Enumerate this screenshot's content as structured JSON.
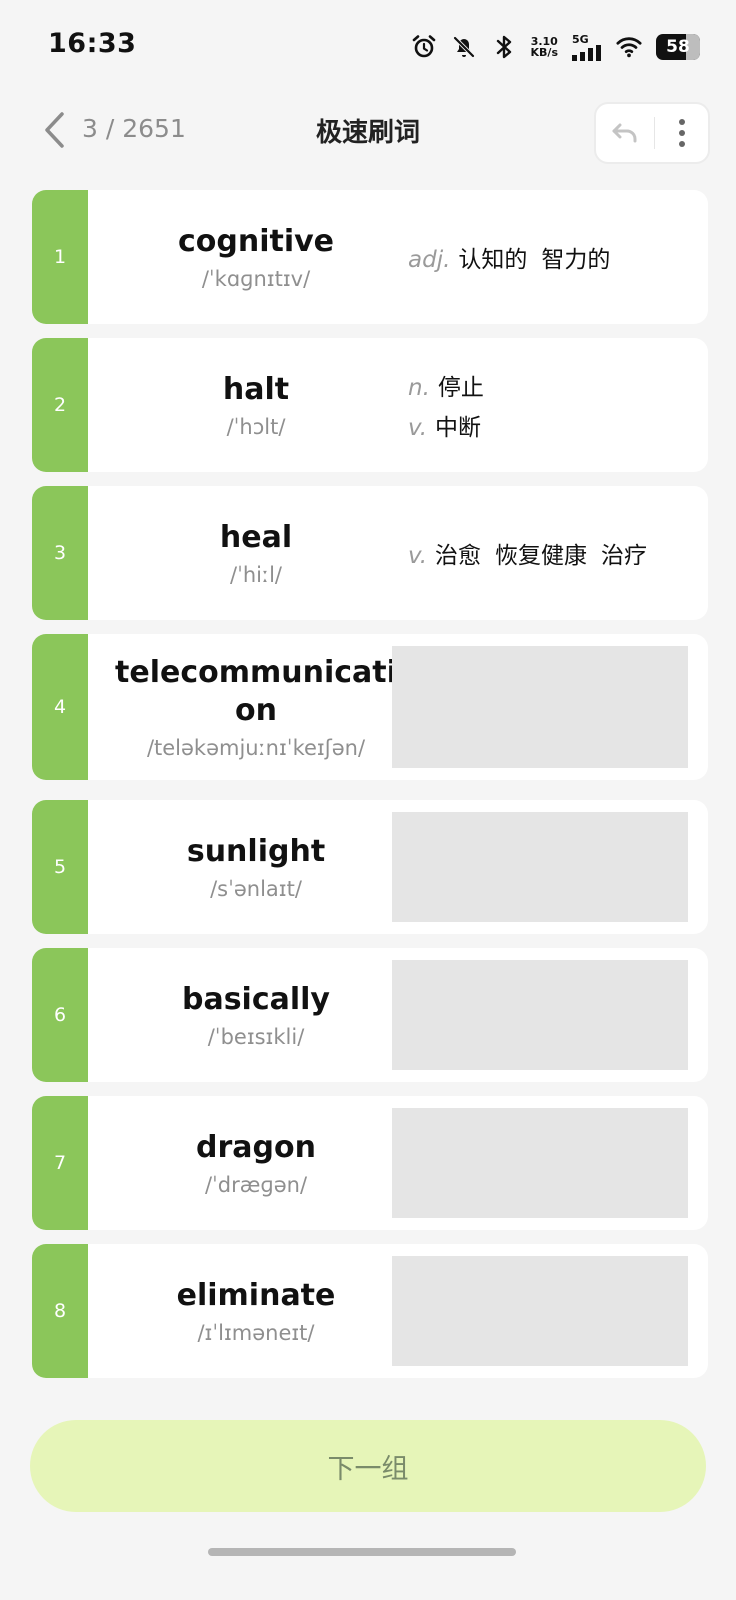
{
  "status_bar": {
    "time": "16:33",
    "net_speed_value": "3.10",
    "net_speed_unit": "KB/s",
    "network_type": "5G",
    "battery": "58",
    "icons": [
      "alarm-icon",
      "bell-off-icon",
      "bluetooth-icon",
      "signal-icon",
      "wifi-icon",
      "battery-icon"
    ]
  },
  "header": {
    "progress": "3 / 2651",
    "title": "极速刷词"
  },
  "words": [
    {
      "index": "1",
      "word": "cognitive",
      "phonetic": "/ˈkɑɡnɪtɪv/",
      "revealed": true,
      "definitions": [
        {
          "pos": "adj.",
          "meanings": [
            "认知的",
            "智力的"
          ]
        }
      ]
    },
    {
      "index": "2",
      "word": "halt",
      "phonetic": "/ˈhɔlt/",
      "revealed": true,
      "definitions": [
        {
          "pos": "n.",
          "meanings": [
            "停止"
          ]
        },
        {
          "pos": "v.",
          "meanings": [
            "中断"
          ]
        }
      ]
    },
    {
      "index": "3",
      "word": "heal",
      "phonetic": "/ˈhiːl/",
      "revealed": true,
      "definitions": [
        {
          "pos": "v.",
          "meanings": [
            "治愈",
            "恢复健康",
            "治疗"
          ]
        }
      ]
    },
    {
      "index": "4",
      "word": "telecommunication",
      "phonetic": "/teləkəmjuːnɪˈkeɪʃən/",
      "revealed": false,
      "definitions": []
    },
    {
      "index": "5",
      "word": "sunlight",
      "phonetic": "/sˈənlaɪt/",
      "revealed": false,
      "definitions": []
    },
    {
      "index": "6",
      "word": "basically",
      "phonetic": "/ˈbeɪsɪkli/",
      "revealed": false,
      "definitions": []
    },
    {
      "index": "7",
      "word": "dragon",
      "phonetic": "/ˈdræɡən/",
      "revealed": false,
      "definitions": []
    },
    {
      "index": "8",
      "word": "eliminate",
      "phonetic": "/ɪˈlɪməneɪt/",
      "revealed": false,
      "definitions": []
    }
  ],
  "next_button": {
    "label": "下一组"
  },
  "colors": {
    "accent": "#8bc65a",
    "button_bg": "#e6f5b8",
    "mask": "#e5e5e5",
    "background": "#f5f5f5"
  }
}
